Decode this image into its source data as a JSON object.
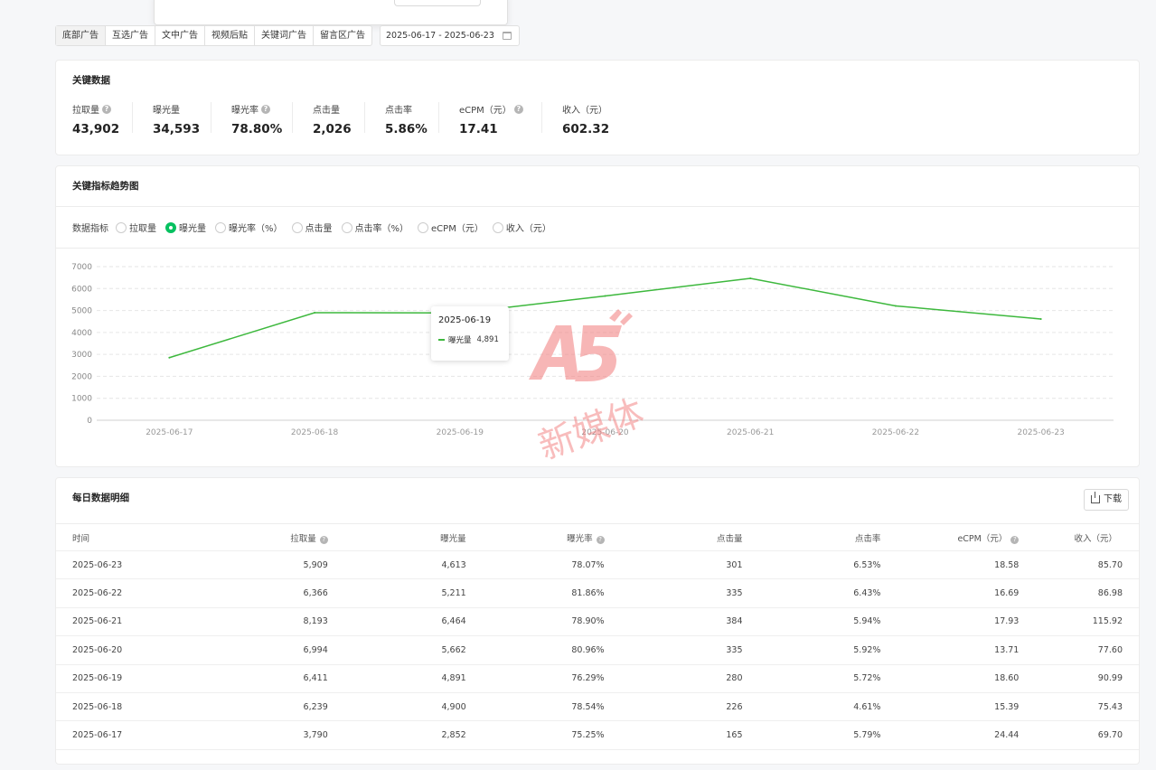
{
  "tabs": [
    "底部广告",
    "互选广告",
    "文中广告",
    "视频后贴",
    "关键词广告",
    "留言区广告"
  ],
  "date_range": "2025-06-17 - 2025-06-23",
  "key_data": {
    "title": "关键数据",
    "metrics": [
      {
        "label": "拉取量",
        "value": "43,902",
        "help": true
      },
      {
        "label": "曝光量",
        "value": "34,593",
        "help": false
      },
      {
        "label": "曝光率",
        "value": "78.80%",
        "help": true
      },
      {
        "label": "点击量",
        "value": "2,026",
        "help": false
      },
      {
        "label": "点击率",
        "value": "5.86%",
        "help": false
      },
      {
        "label": "eCPM（元）",
        "value": "17.41",
        "help": true
      },
      {
        "label": "收入（元）",
        "value": "602.32",
        "help": false
      }
    ]
  },
  "trend": {
    "title": "关键指标趋势图",
    "indicator_label": "数据指标",
    "options": [
      "拉取量",
      "曝光量",
      "曝光率（%）",
      "点击量",
      "点击率（%）",
      "eCPM（元）",
      "收入（元）"
    ],
    "selected": "曝光量",
    "tooltip": {
      "date": "2025-06-19",
      "series": "曝光量",
      "value": "4,891"
    }
  },
  "chart_data": {
    "type": "line",
    "x": [
      "2025-06-17",
      "2025-06-18",
      "2025-06-19",
      "2025-06-20",
      "2025-06-21",
      "2025-06-22",
      "2025-06-23"
    ],
    "series": [
      {
        "name": "曝光量",
        "values": [
          2852,
          4900,
          4891,
          5662,
          6464,
          5211,
          4613
        ],
        "color": "#3db83d"
      }
    ],
    "y_ticks": [
      0,
      1000,
      2000,
      3000,
      4000,
      5000,
      6000,
      7000
    ],
    "ylim": [
      0,
      7000
    ],
    "grid": true
  },
  "daily": {
    "title": "每日数据明细",
    "download_label": "下载",
    "columns": [
      "时间",
      "拉取量",
      "曝光量",
      "曝光率",
      "点击量",
      "点击率",
      "eCPM（元）",
      "收入（元）"
    ],
    "rows": [
      [
        "2025-06-23",
        "5,909",
        "4,613",
        "78.07%",
        "301",
        "6.53%",
        "18.58",
        "85.70"
      ],
      [
        "2025-06-22",
        "6,366",
        "5,211",
        "81.86%",
        "335",
        "6.43%",
        "16.69",
        "86.98"
      ],
      [
        "2025-06-21",
        "8,193",
        "6,464",
        "78.90%",
        "384",
        "5.94%",
        "17.93",
        "115.92"
      ],
      [
        "2025-06-20",
        "6,994",
        "5,662",
        "80.96%",
        "335",
        "5.92%",
        "13.71",
        "77.60"
      ],
      [
        "2025-06-19",
        "6,411",
        "4,891",
        "76.29%",
        "280",
        "5.72%",
        "18.60",
        "90.99"
      ],
      [
        "2025-06-18",
        "6,239",
        "4,900",
        "78.54%",
        "226",
        "4.61%",
        "15.39",
        "75.43"
      ],
      [
        "2025-06-17",
        "3,790",
        "2,852",
        "75.25%",
        "165",
        "5.79%",
        "24.44",
        "69.70"
      ]
    ]
  },
  "watermark": {
    "logo": "A5",
    "text": "新媒体"
  }
}
